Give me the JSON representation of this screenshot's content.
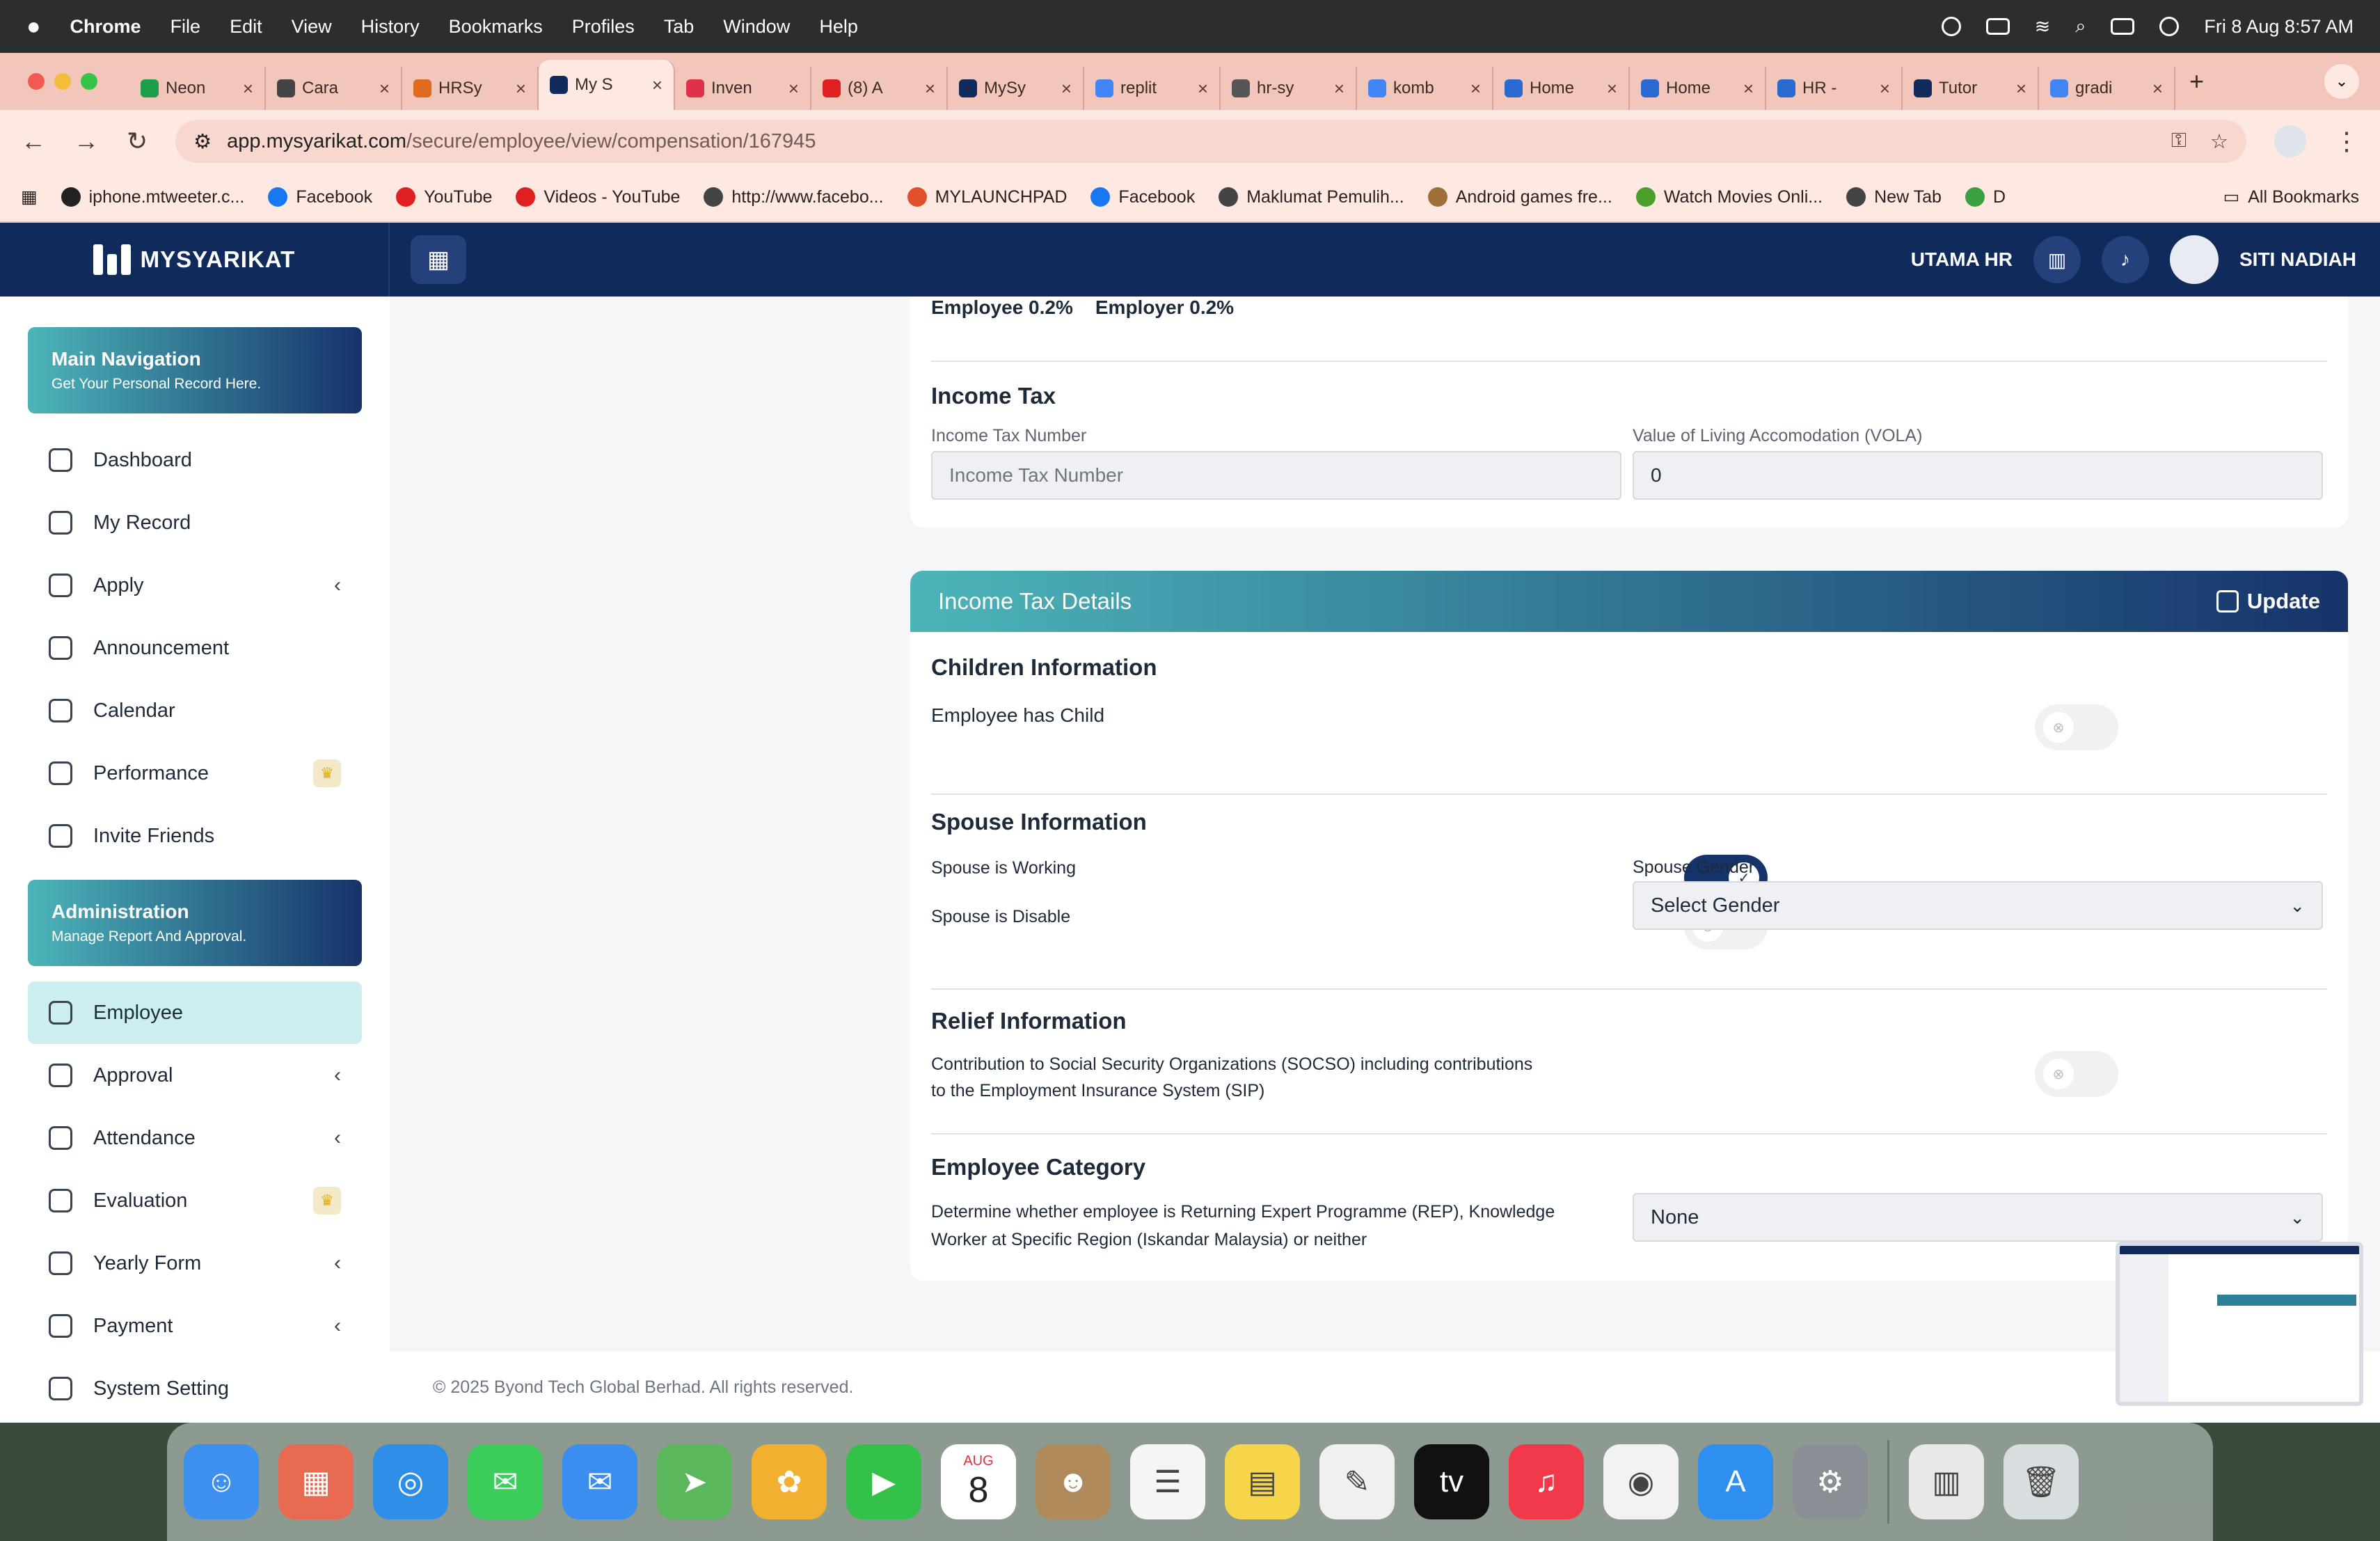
{
  "menubar": {
    "app": "Chrome",
    "items": [
      "File",
      "Edit",
      "View",
      "History",
      "Bookmarks",
      "Profiles",
      "Tab",
      "Window",
      "Help"
    ],
    "datetime": "Fri 8 Aug  8:57 AM"
  },
  "tabs": [
    {
      "title": "Neon",
      "color": "#1e9e4a"
    },
    {
      "title": "Cara",
      "color": "#444444"
    },
    {
      "title": "HRSy",
      "color": "#e06a1e"
    },
    {
      "title": "My S",
      "color": "#102a5c"
    },
    {
      "title": "Inven",
      "color": "#e0304a"
    },
    {
      "title": "(8) A",
      "color": "#e02020"
    },
    {
      "title": "MySy",
      "color": "#102a5c"
    },
    {
      "title": "replit",
      "color": "#4285f4"
    },
    {
      "title": "hr-sy",
      "color": "#555555"
    },
    {
      "title": "komb",
      "color": "#4285f4"
    },
    {
      "title": "Home",
      "color": "#2a6ad0"
    },
    {
      "title": "Home",
      "color": "#2a6ad0"
    },
    {
      "title": "HR -",
      "color": "#2a6ad0"
    },
    {
      "title": "Tutor",
      "color": "#102a5c"
    },
    {
      "title": "gradi",
      "color": "#4285f4"
    }
  ],
  "address": {
    "host": "app.mysyarikat.com",
    "path": "/secure/employee/view/compensation/167945"
  },
  "bookmarks": [
    {
      "label": "iphone.mtweeter.c...",
      "color": "#222222"
    },
    {
      "label": "Facebook",
      "color": "#1877f2"
    },
    {
      "label": "YouTube",
      "color": "#e02020"
    },
    {
      "label": "Videos - YouTube",
      "color": "#e02020"
    },
    {
      "label": "http://www.facebo...",
      "color": "#444444"
    },
    {
      "label": "MYLAUNCHPAD",
      "color": "#e0502a"
    },
    {
      "label": "Facebook",
      "color": "#1877f2"
    },
    {
      "label": "Maklumat Pemulih...",
      "color": "#444444"
    },
    {
      "label": "Android games fre...",
      "color": "#a0703a"
    },
    {
      "label": "Watch Movies Onli...",
      "color": "#4aa02a"
    },
    {
      "label": "New Tab",
      "color": "#444444"
    },
    {
      "label": "D",
      "color": "#3aa040"
    }
  ],
  "bookmarks_all": "All Bookmarks",
  "header": {
    "logo": "MYSYARIKAT",
    "company": "UTAMA HR",
    "user": "SITI NADIAH"
  },
  "sidebar": {
    "main_card": {
      "title": "Main Navigation",
      "subtitle": "Get Your Personal Record Here."
    },
    "main_items": [
      {
        "label": "Dashboard",
        "chevron": ""
      },
      {
        "label": "My Record",
        "chevron": ""
      },
      {
        "label": "Apply",
        "chevron": "‹"
      },
      {
        "label": "Announcement",
        "chevron": ""
      },
      {
        "label": "Calendar",
        "chevron": ""
      },
      {
        "label": "Performance",
        "chevron": "",
        "crown": "♛"
      },
      {
        "label": "Invite Friends",
        "chevron": ""
      }
    ],
    "admin_card": {
      "title": "Administration",
      "subtitle": "Manage Report And Approval."
    },
    "admin_items": [
      {
        "label": "Employee",
        "chevron": ""
      },
      {
        "label": "Approval",
        "chevron": "‹"
      },
      {
        "label": "Attendance",
        "chevron": "‹"
      },
      {
        "label": "Evaluation",
        "chevron": "",
        "crown": "♛"
      },
      {
        "label": "Yearly Form",
        "chevron": "‹"
      },
      {
        "label": "Payment",
        "chevron": "‹"
      },
      {
        "label": "System Setting",
        "chevron": ""
      }
    ]
  },
  "contribution": {
    "employee": "Employee 0.2%",
    "employer": "Employer 0.2%"
  },
  "income_tax": {
    "title": "Income Tax",
    "number_label": "Income Tax Number",
    "number_placeholder": "Income Tax Number",
    "vola_label": "Value of Living Accomodation (VOLA)",
    "vola_value": "0"
  },
  "tax_details": {
    "title": "Income Tax Details",
    "update": "Update",
    "children": {
      "title": "Children Information",
      "has_child": "Employee has Child",
      "has_child_on": false
    },
    "spouse": {
      "title": "Spouse Information",
      "working": "Spouse is Working",
      "working_on": true,
      "disable": "Spouse is Disable",
      "disable_on": false,
      "gender_label": "Spouse Gender",
      "gender_value": "Select Gender"
    },
    "relief": {
      "title": "Relief Information",
      "socso_line1": "Contribution to Social Security Organizations (SOCSO) including contributions",
      "socso_line2": "to the Employment Insurance System (SIP)",
      "socso_on": false
    },
    "category": {
      "title": "Employee Category",
      "desc_line1": "Determine whether employee is Returning Expert Programme (REP), Knowledge",
      "desc_line2": "Worker at Specific Region (Iskandar Malaysia) or neither",
      "value": "None"
    }
  },
  "footer": "© 2025 Byond Tech Global Berhad. All rights reserved.",
  "dock": [
    {
      "name": "finder-icon",
      "color": "#3d8ff0",
      "glyph": "☺"
    },
    {
      "name": "launchpad-icon",
      "color": "#e86a50",
      "glyph": "▦"
    },
    {
      "name": "safari-icon",
      "color": "#2f8fe8",
      "glyph": "◎"
    },
    {
      "name": "messages-icon",
      "color": "#3ccd5a",
      "glyph": "✉"
    },
    {
      "name": "mail-icon",
      "color": "#3a8ef0",
      "glyph": "✉"
    },
    {
      "name": "maps-icon",
      "color": "#5cb85c",
      "glyph": "➤"
    },
    {
      "name": "photos-icon",
      "color": "#f2b030",
      "glyph": "✿"
    },
    {
      "name": "facetime-icon",
      "color": "#33c14a",
      "glyph": "▶"
    },
    {
      "name": "calendar-icon",
      "color": "#ffffff",
      "glyph": "8"
    },
    {
      "name": "contacts-icon",
      "color": "#b08a5a",
      "glyph": "☻"
    },
    {
      "name": "reminders-icon",
      "color": "#f5f5f5",
      "glyph": "☰"
    },
    {
      "name": "notes-icon",
      "color": "#f7d54a",
      "glyph": "▤"
    },
    {
      "name": "freeform-icon",
      "color": "#f0f0f0",
      "glyph": "✎"
    },
    {
      "name": "appletv-icon",
      "color": "#111111",
      "glyph": "tv"
    },
    {
      "name": "music-icon",
      "color": "#f2394a",
      "glyph": "♫"
    },
    {
      "name": "chrome-icon",
      "color": "#f2f2f2",
      "glyph": "◉"
    },
    {
      "name": "appstore-icon",
      "color": "#2f8ff0",
      "glyph": "A"
    },
    {
      "name": "settings-icon",
      "color": "#8a8f96",
      "glyph": "⚙"
    },
    {
      "name": "preview-icon",
      "color": "#e8e8e8",
      "glyph": "▥"
    },
    {
      "name": "trash-icon",
      "color": "#d8dde0",
      "glyph": "🗑"
    }
  ],
  "calendar_dock": {
    "month": "AUG",
    "day": "8"
  }
}
